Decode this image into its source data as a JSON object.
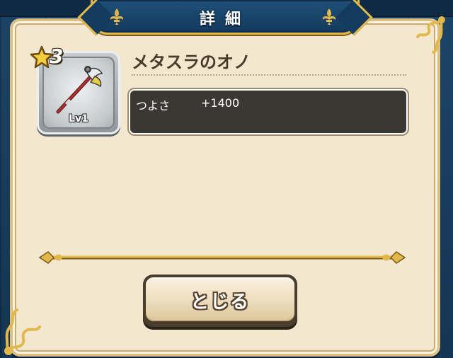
{
  "dialog": {
    "title": "詳細"
  },
  "item": {
    "name": "メタスラのオノ",
    "rarity_stars": "3",
    "level": "Lv1",
    "icon": "axe-icon"
  },
  "stats": [
    {
      "label": "つよさ",
      "value": "+1400"
    }
  ],
  "buttons": {
    "close_label": "とじる"
  },
  "colors": {
    "panel": "#f3e7cf",
    "gold_trim": "#e2b84a",
    "banner": "#1f5078",
    "stat_box": "#3b3732",
    "name_text": "#4b3a26"
  }
}
